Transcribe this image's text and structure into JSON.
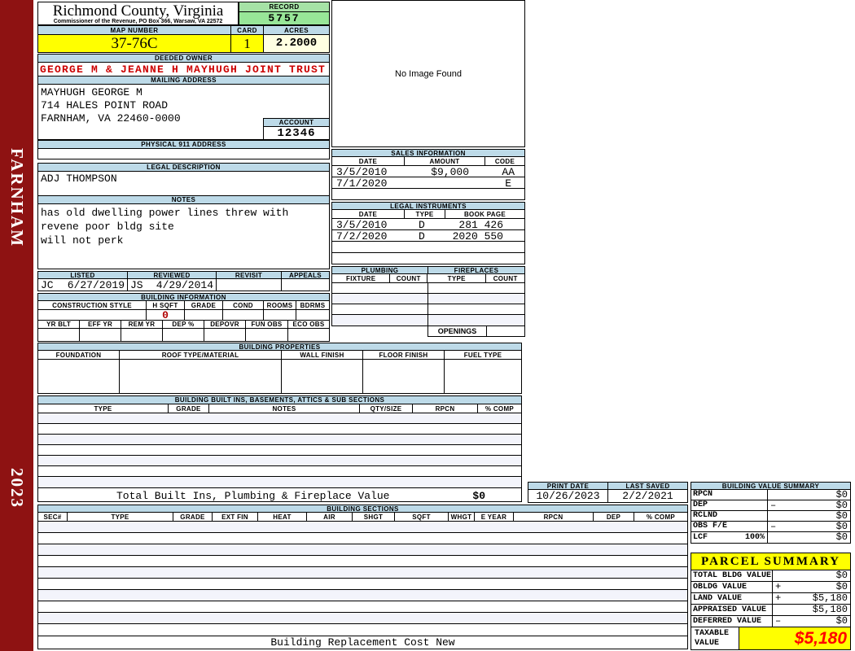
{
  "sidebar": {
    "district": "FARNHAM",
    "year": "2023"
  },
  "county": {
    "title": "Richmond County, Virginia",
    "subtitle": "Commissioner of the Revenue, PO Box 366, Warsaw, VA 22572"
  },
  "record": {
    "label": "RECORD",
    "value": "5757"
  },
  "map": {
    "label": "MAP NUMBER",
    "value": "37-76C"
  },
  "card": {
    "label": "CARD",
    "value": "1"
  },
  "acres": {
    "label": "ACRES",
    "value": "2.2000"
  },
  "owner": {
    "label": "DEEDED OWNER",
    "value": "GEORGE M & JEANNE H MAYHUGH JOINT TRUST"
  },
  "mailing": {
    "label": "MAILING ADDRESS",
    "line1": "MAYHUGH GEORGE M",
    "line2": "714 HALES POINT ROAD",
    "line3": "",
    "line4": "FARNHAM, VA 22460-0000"
  },
  "account": {
    "label": "ACCOUNT",
    "value": "12346"
  },
  "physical911": {
    "label": "PHYSICAL 911 ADDRESS",
    "value": ""
  },
  "legal_description": {
    "label": "LEGAL DESCRIPTION",
    "value": "ADJ THOMPSON"
  },
  "notes": {
    "label": "NOTES",
    "line1": "has old dwelling power lines threw with",
    "line2": "revene poor bldg site",
    "line3": "will not perk"
  },
  "no_image": {
    "text": "No Image Found"
  },
  "sales": {
    "label": "SALES INFORMATION",
    "headers": [
      "DATE",
      "AMOUNT",
      "CODE"
    ],
    "rows": [
      {
        "date": "3/5/2010",
        "amount": "$9,000",
        "code": "AA"
      },
      {
        "date": "7/1/2020",
        "amount": "",
        "code": "E"
      },
      {
        "date": "",
        "amount": "",
        "code": ""
      }
    ]
  },
  "instruments": {
    "label": "LEGAL INSTRUMENTS",
    "headers": [
      "DATE",
      "TYPE",
      "BOOK PAGE"
    ],
    "rows": [
      {
        "date": "3/5/2010",
        "type": "D",
        "book_page": "281 426"
      },
      {
        "date": "7/2/2020",
        "type": "D",
        "book_page": "2020 550"
      },
      {
        "date": "",
        "type": "",
        "book_page": ""
      },
      {
        "date": "",
        "type": "",
        "book_page": ""
      }
    ]
  },
  "plumbing": {
    "label": "PLUMBING",
    "headers": [
      "FIXTURE",
      "COUNT"
    ]
  },
  "fireplaces": {
    "label": "FIREPLACES",
    "headers": [
      "TYPE",
      "COUNT"
    ],
    "openings_label": "OPENINGS",
    "openings_value": ""
  },
  "review": {
    "headers": [
      "LISTED",
      "REVIEWED",
      "REVISIT",
      "APPEALS"
    ],
    "listed_by": "JC",
    "listed_date": "6/27/2019",
    "reviewed_by": "JS",
    "reviewed_date": "4/29/2014",
    "revisit": "",
    "appeals": ""
  },
  "building_information": {
    "label": "BUILDING INFORMATION",
    "row1_headers": [
      "CONSTRUCTION STYLE",
      "H SQFT",
      "GRADE",
      "COND",
      "ROOMS",
      "BDRMS"
    ],
    "h_sqft": "0",
    "row2_headers": [
      "YR BLT",
      "EFF YR",
      "REM YR",
      "DEP %",
      "DEPOVR",
      "FUN OBS",
      "ECO OBS"
    ]
  },
  "building_properties": {
    "label": "BUILDING PROPERTIES",
    "headers": [
      "FOUNDATION",
      "ROOF TYPE/MATERIAL",
      "WALL FINISH",
      "FLOOR FINISH",
      "FUEL TYPE"
    ]
  },
  "built_ins": {
    "label": "BUILDING BUILT INS, BASEMENTS, ATTICS & SUB SECTIONS",
    "headers": [
      "TYPE",
      "GRADE",
      "NOTES",
      "QTY/SIZE",
      "RPCN",
      "% COMP"
    ],
    "total_label": "Total Built Ins, Plumbing & Fireplace Value",
    "total_value": "$0"
  },
  "print_info": {
    "print_date_label": "PRINT DATE",
    "print_date": "10/26/2023",
    "last_saved_label": "LAST SAVED",
    "last_saved": "2/2/2021"
  },
  "building_value_summary": {
    "label": "BUILDING VALUE SUMMARY",
    "rows": [
      {
        "name": "RPCN",
        "pct": "",
        "op": "",
        "value": "$0"
      },
      {
        "name": "DEP",
        "pct": "",
        "op": "–",
        "value": "$0"
      },
      {
        "name": "RCLND",
        "pct": "",
        "op": "",
        "value": "$0"
      },
      {
        "name": "OBS F/E",
        "pct": "",
        "op": "–",
        "value": "$0"
      },
      {
        "name": "LCF",
        "pct": "100%",
        "op": "",
        "value": "$0"
      }
    ]
  },
  "building_sections": {
    "label": "BUILDING SECTIONS",
    "headers": [
      "SEC#",
      "TYPE",
      "GRADE",
      "EXT FIN",
      "HEAT",
      "AIR",
      "SHGT",
      "SQFT",
      "WHGT",
      "E YEAR",
      "RPCN",
      "DEP",
      "% COMP"
    ]
  },
  "parcel_summary": {
    "label": "PARCEL SUMMARY",
    "rows": [
      {
        "name": "TOTAL BLDG VALUE",
        "op": "",
        "value": "$0"
      },
      {
        "name": "OBLDG VALUE",
        "op": "+",
        "value": "$0"
      },
      {
        "name": "LAND VALUE",
        "op": "+",
        "value": "$5,180"
      },
      {
        "name": "APPRAISED VALUE",
        "op": "",
        "value": "$5,180"
      },
      {
        "name": "DEFERRED VALUE",
        "op": "–",
        "value": "$0"
      }
    ],
    "taxable_label": "TAXABLE VALUE",
    "taxable_value": "$5,180"
  },
  "footer": {
    "label": "Building Replacement Cost New"
  },
  "colors": {
    "band_blue": "#BDDAE8",
    "record_green": "#98E698",
    "record_green_header": "#A6E2A6",
    "highlight_yellow": "#FFFF00",
    "acres_cream": "#FFFFE2",
    "sidebar_maroon": "#8E1212",
    "owner_red": "#CC0000",
    "taxable_red": "#FF0000",
    "alt_row": "#F3F4FB"
  }
}
